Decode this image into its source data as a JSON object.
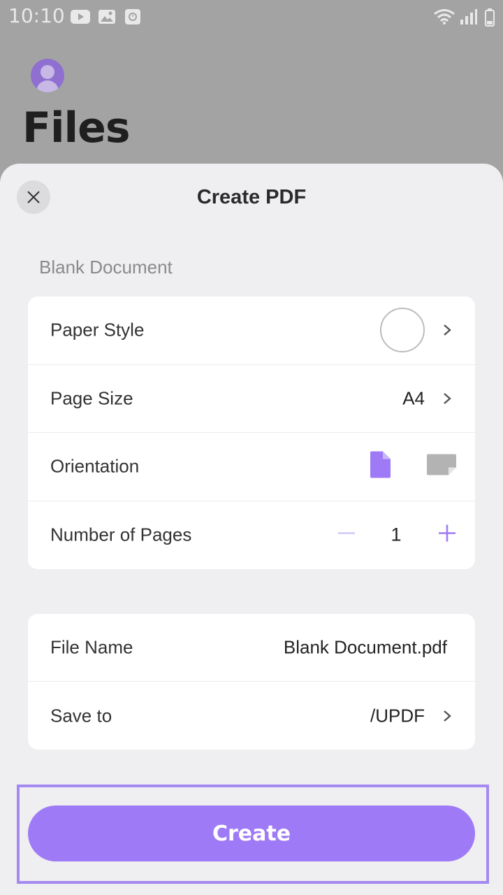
{
  "status_bar": {
    "time": "10:10",
    "icons": [
      "youtube-icon",
      "image-icon",
      "clock-icon",
      "wifi-icon",
      "signal-icon",
      "battery-icon"
    ]
  },
  "background_page": {
    "title": "Files",
    "avatar_icon": "user-avatar-icon"
  },
  "sheet": {
    "title": "Create PDF",
    "close_icon": "close-icon",
    "section_label": "Blank Document",
    "settings": {
      "paper_style": {
        "label": "Paper Style",
        "value_icon": "blank-paper-circle"
      },
      "page_size": {
        "label": "Page Size",
        "value": "A4"
      },
      "orientation": {
        "label": "Orientation",
        "selected": "portrait",
        "options": [
          "portrait",
          "landscape"
        ]
      },
      "number_of_pages": {
        "label": "Number of Pages",
        "value": "1"
      }
    },
    "file": {
      "file_name": {
        "label": "File Name",
        "value": "Blank Document.pdf"
      },
      "save_to": {
        "label": "Save to",
        "value": "/UPDF"
      }
    },
    "create_button": {
      "label": "Create"
    }
  },
  "colors": {
    "accent": "#9f7af6",
    "accent_light": "#c8b6f8",
    "sheet_bg": "#efeef1",
    "overlay_bg": "#a3a3a3"
  }
}
